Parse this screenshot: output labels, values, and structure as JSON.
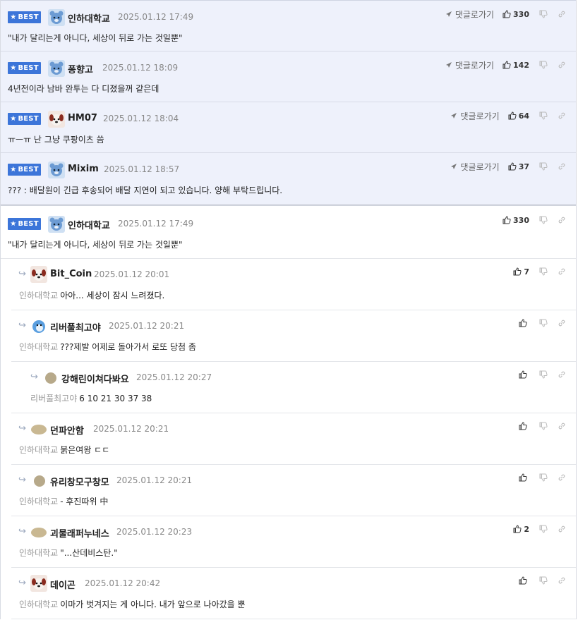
{
  "best_badge_label": "BEST",
  "goto_label": "댓글로가기",
  "best_comments": [
    {
      "nick": "인하대학교",
      "date": "2025.01.12 17:49",
      "text": "\"내가 달리는게 아니다, 세상이 뒤로 가는 것일뿐\"",
      "likes": "330",
      "avatar": "blue-bear"
    },
    {
      "nick": "퐁향고",
      "date": "2025.01.12 18:09",
      "text": "4년전이라 남바 완투는 다 디졌을꺼 같은데",
      "likes": "142",
      "avatar": "blue-bear"
    },
    {
      "nick": "HM07",
      "date": "2025.01.12 18:04",
      "text": "ㅠㅡㅠ 난 그냥 쿠팡이츠 씀",
      "likes": "64",
      "avatar": "red-dog"
    },
    {
      "nick": "Mixim",
      "date": "2025.01.12 18:57",
      "text": "??? : 배달원이 긴급 후송되어 배달 지연이 되고 있습니다. 양해 부탁드립니다.",
      "likes": "37",
      "avatar": "blue-bear"
    }
  ],
  "thread_head": {
    "nick": "인하대학교",
    "date": "2025.01.12 17:49",
    "text": "\"내가 달리는게 아니다, 세상이 뒤로 가는 것일뿐\"",
    "likes": "330"
  },
  "replies": [
    {
      "nick": "Bit_Coin",
      "date": "2025.01.12 20:01",
      "to": "인하대학교",
      "text": "아아... 세상이 잠시 느려졌다.",
      "likes": "7"
    },
    {
      "nick": "리버풀최고야",
      "date": "2025.01.12 20:21",
      "to": "인하대학교",
      "text": "???제발 어제로 돌아가서 로또 당첨 좀",
      "likes": ""
    },
    {
      "nick": "강해린이쳐다봐요",
      "date": "2025.01.12 20:27",
      "to": "리버풀최고야",
      "text": "6 10 21 30 37 38",
      "likes": ""
    },
    {
      "nick": "던파안함",
      "date": "2025.01.12 20:21",
      "to": "인하대학교",
      "text": "붉은여왕 ㄷㄷ",
      "likes": ""
    },
    {
      "nick": "유리창모구창모",
      "date": "2025.01.12 20:21",
      "to": "인하대학교",
      "text": "- 후진따위 中",
      "likes": ""
    },
    {
      "nick": "괴물래퍼누네스",
      "date": "2025.01.12 20:23",
      "to": "인하대학교",
      "text": "\"...산데비스탄.\"",
      "likes": "2"
    },
    {
      "nick": "데이곤",
      "date": "2025.01.12 20:42",
      "to": "인하대학교",
      "text": "이마가 벗겨지는 게 아니다. 내가 앞으로 나아갔을 뿐",
      "likes": ""
    }
  ],
  "colors": {
    "best_badge": "#3c75d9",
    "best_bg": "#eef1fb",
    "reply_arrow": "#9aa7bd"
  }
}
